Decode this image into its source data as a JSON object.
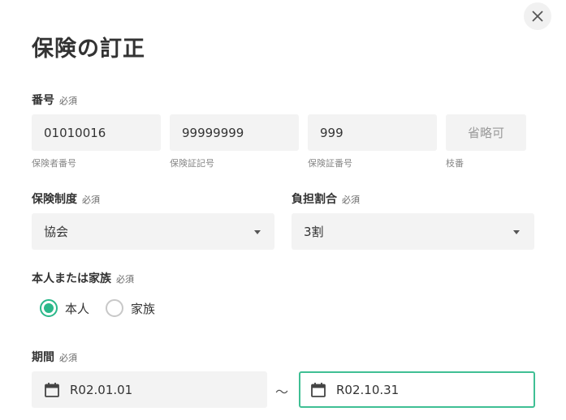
{
  "dialog": {
    "title": "保険の訂正",
    "close_label": "×"
  },
  "number": {
    "label": "番号",
    "required": "必須",
    "fields": [
      {
        "value": "01010016",
        "helper": "保険者番号"
      },
      {
        "value": "99999999",
        "helper": "保険証記号"
      },
      {
        "value": "999",
        "helper": "保険証番号"
      },
      {
        "placeholder": "省略可",
        "helper": "枝番"
      }
    ]
  },
  "insurance_system": {
    "label": "保険制度",
    "required": "必須",
    "selected": "協会"
  },
  "copay_ratio": {
    "label": "負担割合",
    "required": "必須",
    "selected": "3割"
  },
  "person_or_family": {
    "label": "本人または家族",
    "required": "必須",
    "options": [
      {
        "label": "本人",
        "checked": true
      },
      {
        "label": "家族",
        "checked": false
      }
    ]
  },
  "period": {
    "label": "期間",
    "required": "必須",
    "start": "R02.01.01",
    "separator": "～",
    "end": "R02.10.31"
  },
  "colors": {
    "accent": "#2bb88a",
    "field_bg": "#f3f3f3"
  },
  "icons": {
    "close": "close-icon",
    "calendar": "calendar-icon",
    "dropdown": "chevron-down-icon"
  }
}
